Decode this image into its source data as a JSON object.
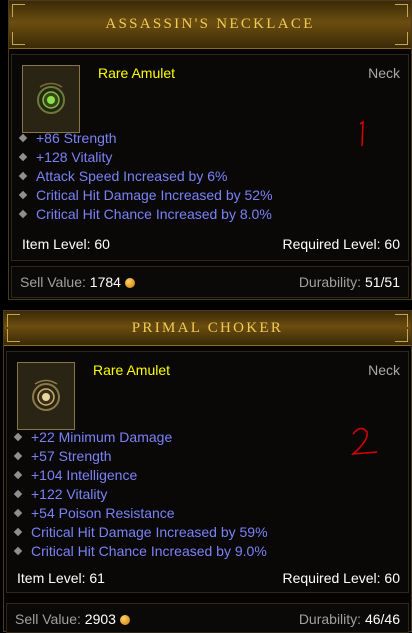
{
  "items": [
    {
      "name": "ASSASSIN'S NECKLACE",
      "type": "Rare Amulet",
      "slot": "Neck",
      "affixes": [
        "+86 Strength",
        "+128 Vitality",
        "Attack Speed Increased by 6%",
        "Critical Hit Damage Increased by 52%",
        "Critical Hit Chance Increased by 8.0%"
      ],
      "item_level_label": "Item Level: 60",
      "required_level_label": "Required Level: 60",
      "sell_label": "Sell Value: ",
      "sell_value": "1784",
      "durability_label": "Durability: ",
      "durability_value": "51/51",
      "annotation": "1"
    },
    {
      "name": "PRIMAL CHOKER",
      "type": "Rare Amulet",
      "slot": "Neck",
      "affixes": [
        "+22 Minimum Damage",
        "+57 Strength",
        "+104 Intelligence",
        "+122 Vitality",
        "+54 Poison Resistance",
        "Critical Hit Damage Increased by 59%",
        "Critical Hit Chance Increased by 9.0%"
      ],
      "item_level_label": "Item Level: 61",
      "required_level_label": "Required Level: 60",
      "sell_label": "Sell Value: ",
      "sell_value": "2903",
      "durability_label": "Durability: ",
      "durability_value": "46/46",
      "annotation": "2"
    }
  ],
  "colors": {
    "title": "#f2cc52",
    "rare": "#ffff00",
    "affix": "#7a82f7",
    "annotation": "#e00000"
  },
  "icons": [
    "amulet-icon",
    "gold-coin-icon"
  ]
}
